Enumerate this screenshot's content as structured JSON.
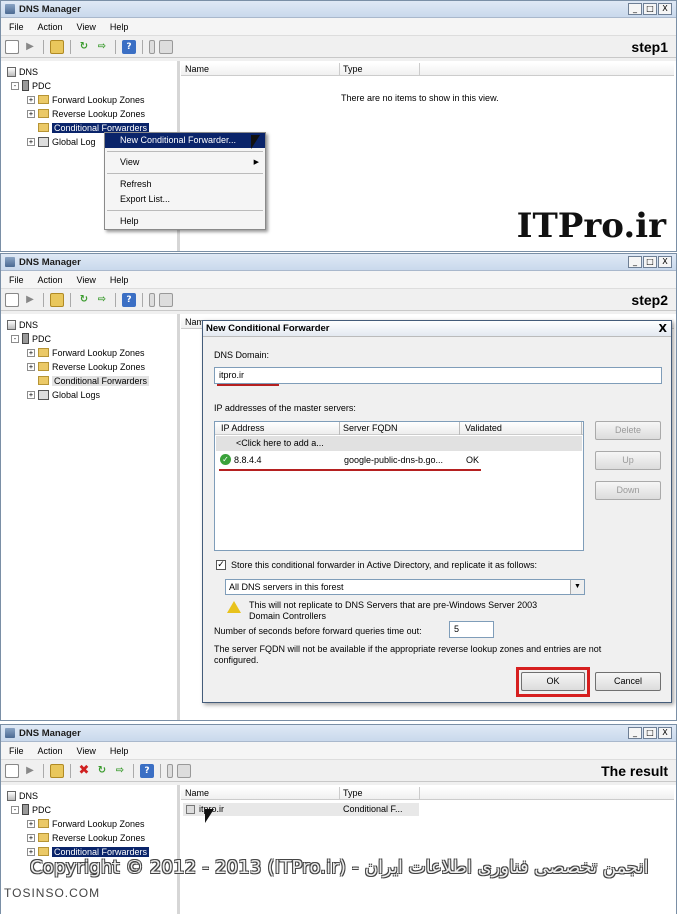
{
  "app_title": "DNS Manager",
  "window_buttons": [
    "_",
    "□",
    "X"
  ],
  "menu": [
    "File",
    "Action",
    "View",
    "Help"
  ],
  "brand": "ITPro.ir",
  "panels": [
    {
      "step": "step1"
    },
    {
      "step": "step2"
    },
    {
      "step": "The result"
    }
  ],
  "tree": {
    "root": "DNS",
    "server": "PDC",
    "forward": "Forward Lookup Zones",
    "reverse": "Reverse Lookup Zones",
    "conditional": "Conditional Forwarders",
    "global_logs": "Global Logs",
    "global_logs_short": "Global Log"
  },
  "columns": {
    "name": "Name",
    "type": "Type"
  },
  "empty_text": "There are no items to show in this view.",
  "context_menu": {
    "items": [
      "New Conditional Forwarder...",
      "View",
      "Refresh",
      "Export List...",
      "Help"
    ]
  },
  "dialog": {
    "title": "New Conditional Forwarder",
    "close": "X",
    "dns_domain_label": "DNS Domain:",
    "dns_domain_value": "itpro.ir",
    "master_label": "IP addresses of the master servers:",
    "grid_headers": [
      "IP Address",
      "Server FQDN",
      "Validated"
    ],
    "click_to_add": "<Click here to add a...",
    "row": {
      "ip": "8.8.4.4",
      "fqdn": "google-public-dns-b.go...",
      "validated": "OK"
    },
    "buttons": {
      "delete": "Delete",
      "up": "Up",
      "down": "Down",
      "ok": "OK",
      "cancel": "Cancel"
    },
    "store_checkbox": "Store this conditional forwarder in Active Directory, and replicate it as follows:",
    "replication_option": "All DNS servers in this forest",
    "warning_line1": "This will not replicate to DNS Servers that are pre-Windows Server 2003",
    "warning_line2": "Domain Controllers",
    "timeout_label": "Number of seconds before forward queries time out:",
    "timeout_value": "5",
    "fqdn_note_line1": "The server FQDN will not be available if the appropriate reverse lookup zones and entries are not",
    "fqdn_note_line2": "configured."
  },
  "result_row": {
    "name": "itpro.ir",
    "type": "Conditional F..."
  },
  "footer": {
    "copyright": "Copyright © 2012 - 2013 (ITPro.ir) - انجمن تخصصی فناوری اطلاعات ایران",
    "watermark": "TOSINSO.COM"
  }
}
